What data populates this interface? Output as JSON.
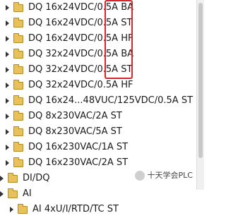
{
  "tree": {
    "items": [
      {
        "label": "DQ 16x24VDC/0.5A BA"
      },
      {
        "label": "DQ 16x24VDC/0.5A ST"
      },
      {
        "label": "DQ 16x24VDC/0.5A HF"
      },
      {
        "label": "DQ 32x24VDC/0.5A BA"
      },
      {
        "label": "DQ 32x24VDC/0.5A ST"
      },
      {
        "label": "DQ 32x24VDC/0.5A HF"
      },
      {
        "label": "DQ 16x24...48VUC/125VDC/0.5A ST"
      },
      {
        "label": "DQ 8x230VAC/2A ST"
      },
      {
        "label": "DQ 8x230VAC/5A ST"
      },
      {
        "label": "DQ 16x230VAC/1A ST"
      },
      {
        "label": "DQ 16x230VAC/2A ST"
      }
    ],
    "folders": [
      {
        "label": "DI/DQ"
      },
      {
        "label": "AI"
      }
    ],
    "ai_child": {
      "label": "AI 4xU/I/RTD/TC ST"
    }
  },
  "watermark": {
    "text": "十天学会PLC"
  }
}
